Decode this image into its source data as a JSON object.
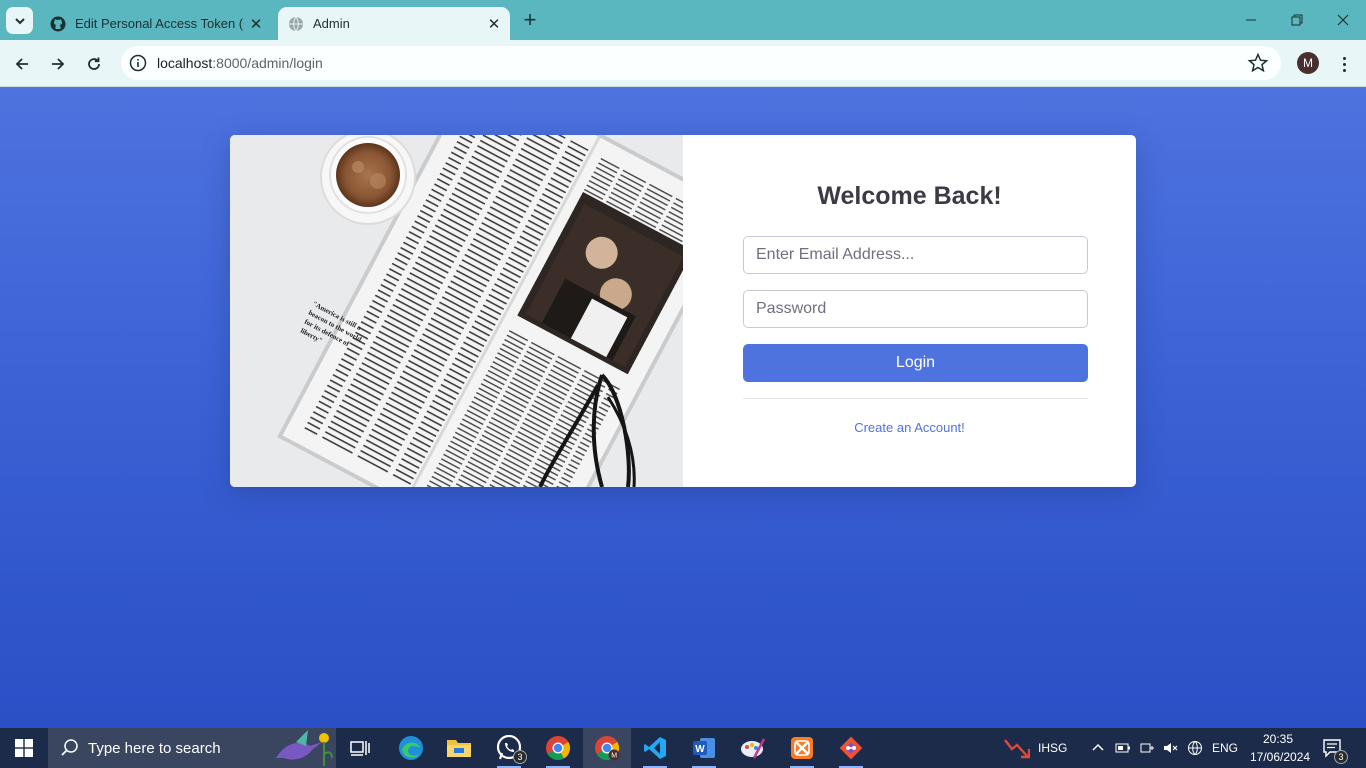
{
  "browser": {
    "tabs": [
      {
        "title": "Edit Personal Access Token (Cla",
        "favicon": "github-icon",
        "active": false
      },
      {
        "title": "Admin",
        "favicon": "globe-icon",
        "active": true
      }
    ],
    "url_host": "localhost",
    "url_path": ":8000/admin/login",
    "profile_initial": "M"
  },
  "login": {
    "heading": "Welcome Back!",
    "email_placeholder": "Enter Email Address...",
    "password_placeholder": "Password",
    "login_label": "Login",
    "create_account_label": "Create an Account!",
    "image_caption": "\"America is still a beacon to the world for its defence of liberty\""
  },
  "taskbar": {
    "search_placeholder": "Type here to search",
    "apps": [
      {
        "name": "task-view",
        "badge": ""
      },
      {
        "name": "edge",
        "badge": ""
      },
      {
        "name": "file-explorer",
        "badge": ""
      },
      {
        "name": "whatsapp",
        "badge": "3"
      },
      {
        "name": "chrome",
        "badge": ""
      },
      {
        "name": "chrome-profile",
        "badge": ""
      },
      {
        "name": "vscode",
        "badge": ""
      },
      {
        "name": "word",
        "badge": ""
      },
      {
        "name": "paint",
        "badge": ""
      },
      {
        "name": "xampp",
        "badge": ""
      },
      {
        "name": "git",
        "badge": ""
      }
    ],
    "stock_label": "IHSG",
    "language": "ENG",
    "time": "20:35",
    "date": "17/06/2024",
    "notification_count": "3"
  },
  "colors": {
    "primary": "#4e73df",
    "tabstrip": "#5ab7bf",
    "toolbar": "#e8f6f7",
    "taskbar": "#1c2b4a"
  }
}
